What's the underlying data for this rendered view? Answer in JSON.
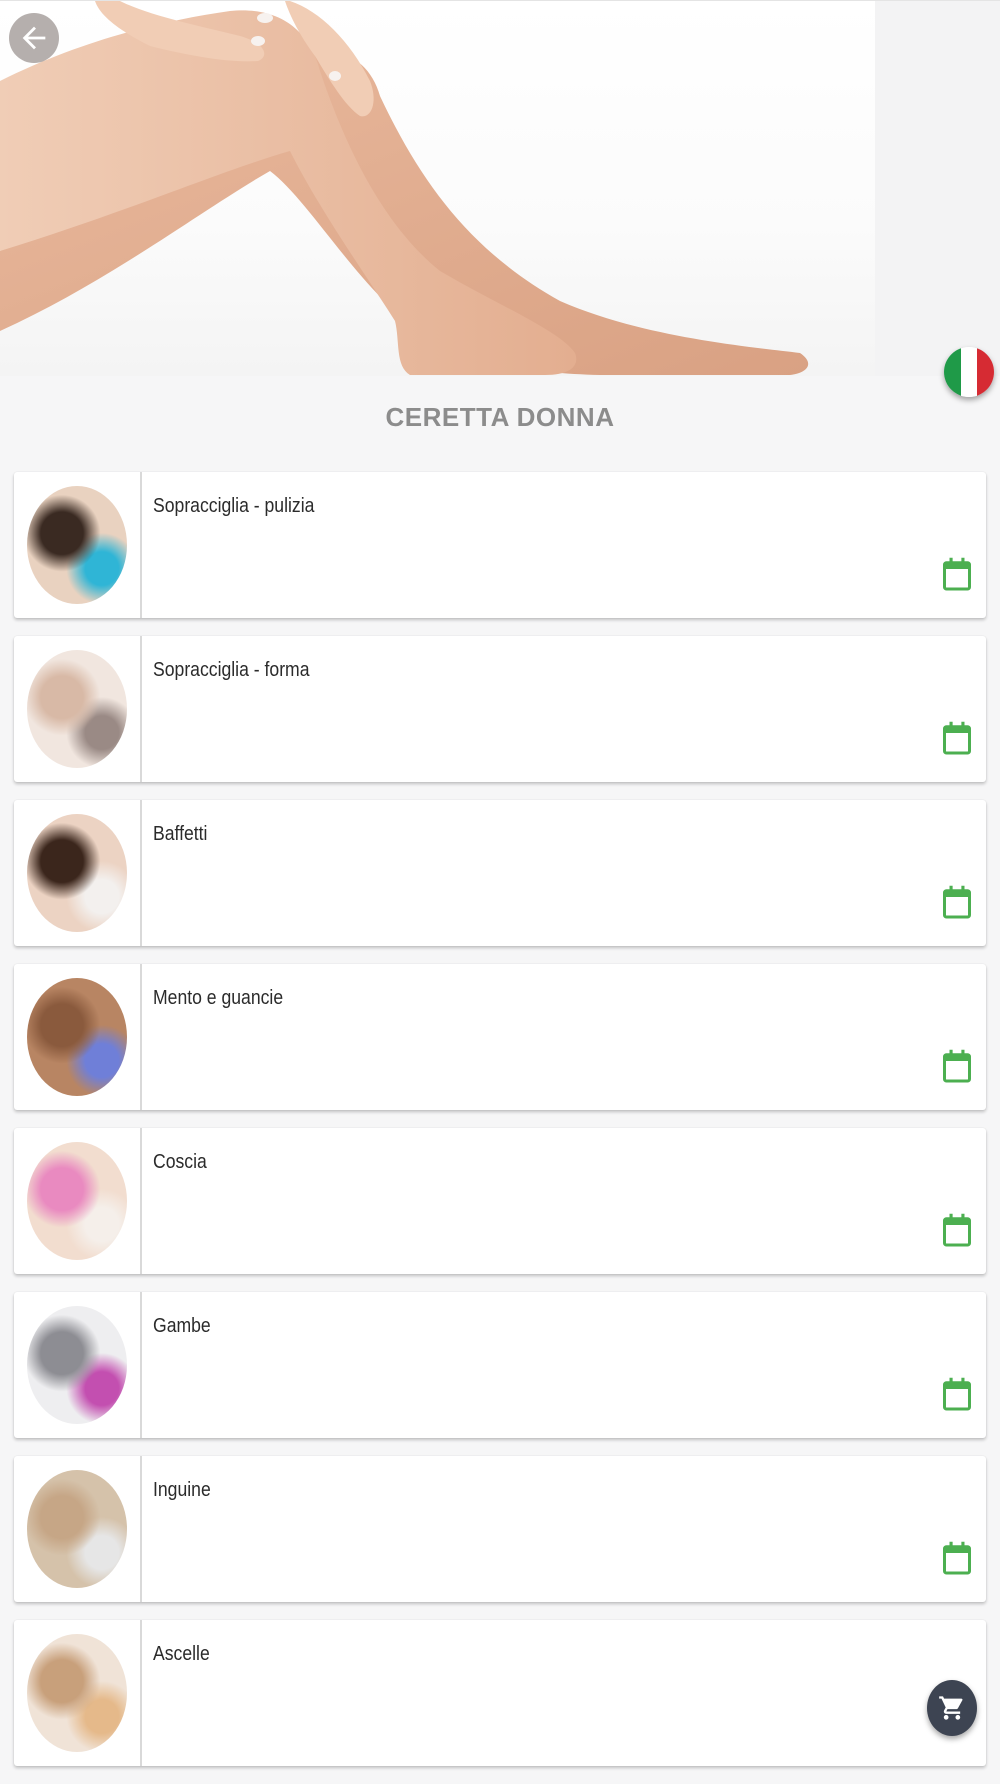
{
  "header": {
    "back_icon": "arrow-left-icon",
    "language_flag": "italy-flag-icon"
  },
  "page": {
    "title": "CERETTA DONNA"
  },
  "services": [
    {
      "label": "Sopracciglia - pulizia",
      "thumb_colors": [
        "#e9d2c0",
        "#3a2a22",
        "#2fb5d6"
      ]
    },
    {
      "label": "Sopracciglia - forma",
      "thumb_colors": [
        "#f1e6df",
        "#d8b9a6",
        "#9a8a85"
      ]
    },
    {
      "label": "Baffetti",
      "thumb_colors": [
        "#ecd3c3",
        "#3b261c",
        "#f3f0ee"
      ]
    },
    {
      "label": "Mento e guancie",
      "thumb_colors": [
        "#b88563",
        "#8a5a3d",
        "#6f7fd8"
      ]
    },
    {
      "label": "Coscia",
      "thumb_colors": [
        "#f2ddcf",
        "#e98ac0",
        "#f5efea"
      ]
    },
    {
      "label": "Gambe",
      "thumb_colors": [
        "#eeeef0",
        "#8d8d93",
        "#c34fb0"
      ]
    },
    {
      "label": "Inguine",
      "thumb_colors": [
        "#d5c2aa",
        "#c6a686",
        "#e6e6e6"
      ]
    },
    {
      "label": "Ascelle",
      "thumb_colors": [
        "#f0e3d7",
        "#c8a07b",
        "#e5b98a"
      ]
    }
  ],
  "icons": {
    "calendar": "calendar-icon",
    "cart": "shopping-cart-icon"
  },
  "colors": {
    "accent_green": "#4caf50",
    "cart_bg": "#3d4452",
    "title": "#8c8c8c"
  }
}
